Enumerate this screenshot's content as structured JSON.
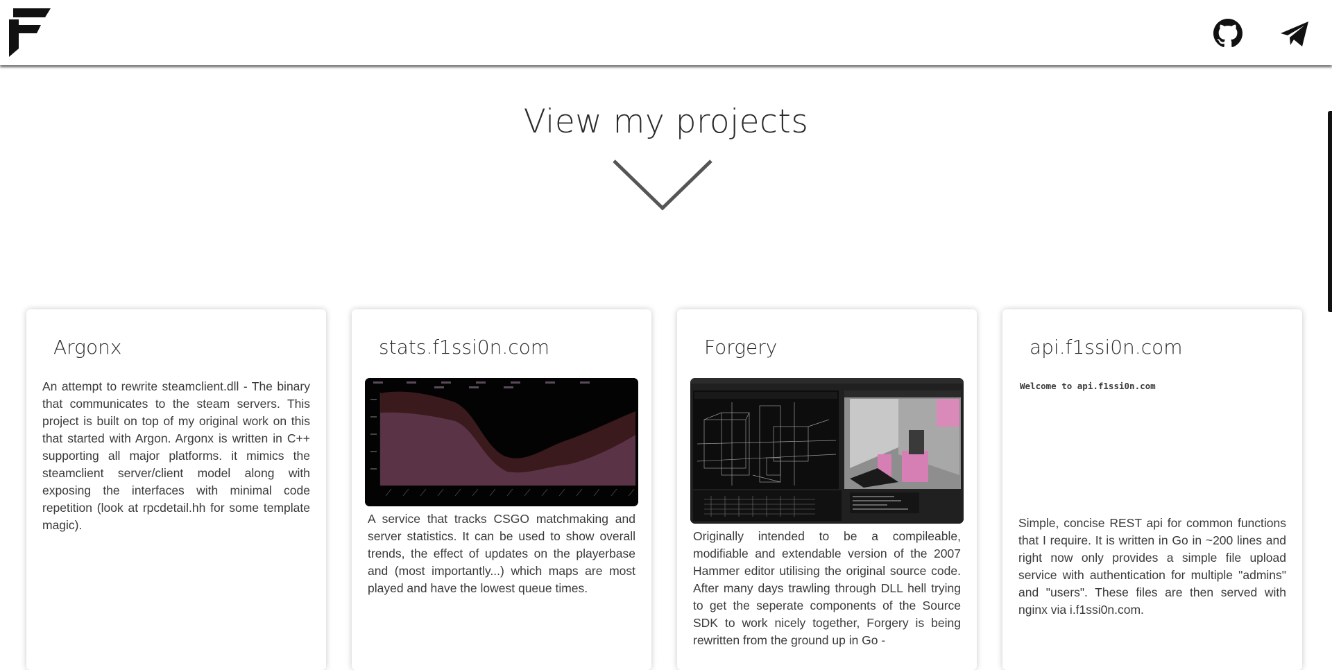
{
  "header": {
    "logo_alt": "F",
    "icons": [
      "github-icon",
      "telegram-icon"
    ]
  },
  "hero": {
    "title": "View my projects"
  },
  "projects": [
    {
      "title": "Argonx",
      "description": "An attempt to rewrite steamclient.dll - The binary that communicates to the steam servers. This project is built on top of my original work on this that started with Argon. Argonx is written in C++ supporting all major platforms. it mimics the steamclient server/client model along with exposing the interfaces with minimal code repetition (look at rpcdetail.hh for some template magic)."
    },
    {
      "title": "stats.f1ssi0n.com",
      "description": "A service that tracks CSGO matchmaking and server statistics. It can be used to show overall trends, the effect of updates on the playerbase and (most importantly...) which maps are most played and have the lowest queue times."
    },
    {
      "title": "Forgery",
      "description": "Originally intended to be a compileable, modifiable and extendable version of the 2007 Hammer editor utilising the original source code. After many days trawling through DLL hell trying to get the seperate components of the Source SDK to work nicely together, Forgery is being rewritten from the ground up in Go -"
    },
    {
      "title": "api.f1ssi0n.com",
      "welcome": "Welcome to api.f1ssi0n.com",
      "description": "Simple, concise REST api for common functions that I require. It is written in Go in ~200 lines and right now only provides a simple file upload service with authentication for multiple \"admins\" and \"users\". These files are then served with nginx via i.f1ssi0n.com."
    }
  ],
  "colors": {
    "background": "#ffffff",
    "text": "#2b2b2b",
    "chart_fill": "#5a3446",
    "chart_band": "#3a1a1c"
  }
}
